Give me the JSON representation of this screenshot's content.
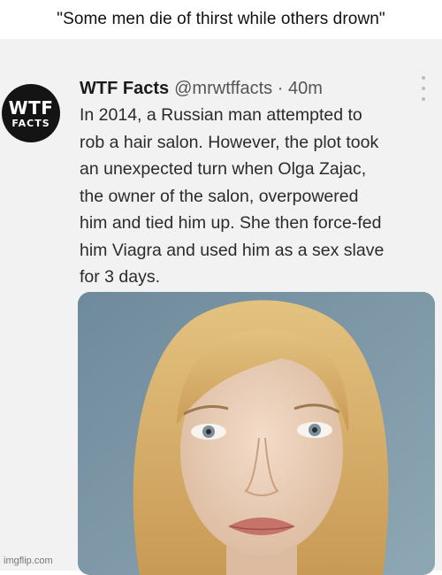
{
  "meme": {
    "caption": "\"Some men die of thirst while others drown\"",
    "watermark": "imgflip.com"
  },
  "tweet": {
    "avatar": {
      "line1": "WTF",
      "line2": "FACTS"
    },
    "author_name": "WTF Facts",
    "handle_time": "@mrwtffacts · 40m",
    "lines": [
      "In 2014, a Russian man attempted to",
      "rob a hair salon. However, the plot took",
      "an unexpected turn when Olga Zajac,",
      "the owner of the salon, overpowered",
      "him and tied him up. She then force-fed",
      "him Viagra and used him as a sex slave",
      "for 3 days."
    ],
    "more_icon": "vertical-ellipsis-icon"
  },
  "colors": {
    "page_bg": "#ffffff",
    "tweet_bg": "#f2f2f2",
    "text": "#2b2b2b",
    "avatar_bg": "#141414",
    "photo_bg": "#7f98a8",
    "hair": "#d9b46c"
  }
}
